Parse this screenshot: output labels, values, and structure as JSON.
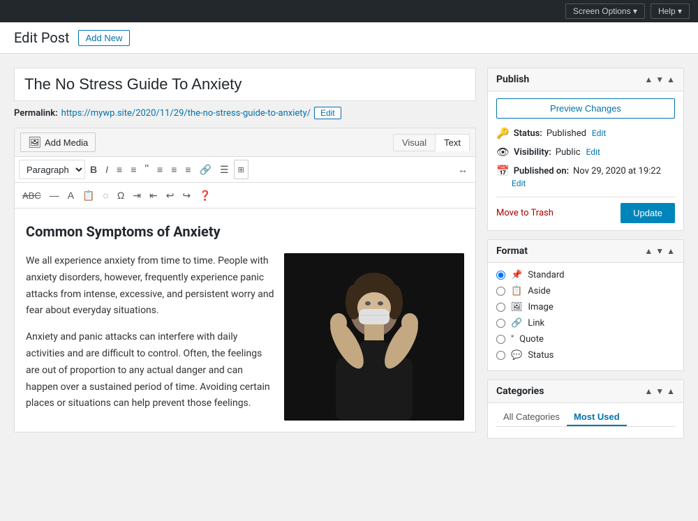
{
  "topbar": {
    "screen_options": "Screen Options",
    "help": "Help"
  },
  "header": {
    "page_title": "Edit Post",
    "add_new_label": "Add New"
  },
  "editor": {
    "post_title": "The No Stress Guide To Anxiety",
    "permalink_label": "Permalink:",
    "permalink_url": "https://mywp.site/2020/11/29/the-no-stress-guide-to-anxiety/",
    "permalink_edit_label": "Edit",
    "add_media_label": "Add Media",
    "view_visual": "Visual",
    "view_text": "Text",
    "toolbar": {
      "paragraph_select": "Paragraph",
      "buttons": [
        "B",
        "I",
        "≡",
        "≡",
        "❝",
        "≡",
        "≡",
        "≡",
        "🔗",
        "☰",
        "⊞",
        "↔"
      ]
    },
    "content_heading": "Common Symptoms of Anxiety",
    "content_para1": "We all experience anxiety from time to time. People with anxiety disorders, however, frequently experience panic attacks from intense, excessive, and persistent worry and fear about everyday situations.",
    "content_para2": "Anxiety and panic attacks can interfere with daily activities and are difficult to control. Often, the feelings are out of proportion to any actual danger and can happen over a sustained period of time. Avoiding certain places or situations can help prevent those feelings."
  },
  "publish_box": {
    "title": "Publish",
    "preview_btn": "Preview Changes",
    "status_label": "Status:",
    "status_value": "Published",
    "status_edit": "Edit",
    "visibility_label": "Visibility:",
    "visibility_value": "Public",
    "visibility_edit": "Edit",
    "published_on_label": "Published on:",
    "published_on_value": "Nov 29, 2020 at 19:22",
    "published_on_edit": "Edit",
    "move_to_trash": "Move to Trash",
    "update_btn": "Update"
  },
  "format_box": {
    "title": "Format",
    "options": [
      {
        "id": "standard",
        "label": "Standard",
        "icon": "📌",
        "checked": true
      },
      {
        "id": "aside",
        "label": "Aside",
        "icon": "📋",
        "checked": false
      },
      {
        "id": "image",
        "label": "Image",
        "icon": "🖼",
        "checked": false
      },
      {
        "id": "link",
        "label": "Link",
        "icon": "🔗",
        "checked": false
      },
      {
        "id": "quote",
        "label": "Quote",
        "icon": "❝",
        "checked": false
      },
      {
        "id": "status",
        "label": "Status",
        "icon": "💬",
        "checked": false
      }
    ]
  },
  "categories_box": {
    "title": "Categories",
    "tab_all": "All Categories",
    "tab_most_used": "Most Used"
  }
}
